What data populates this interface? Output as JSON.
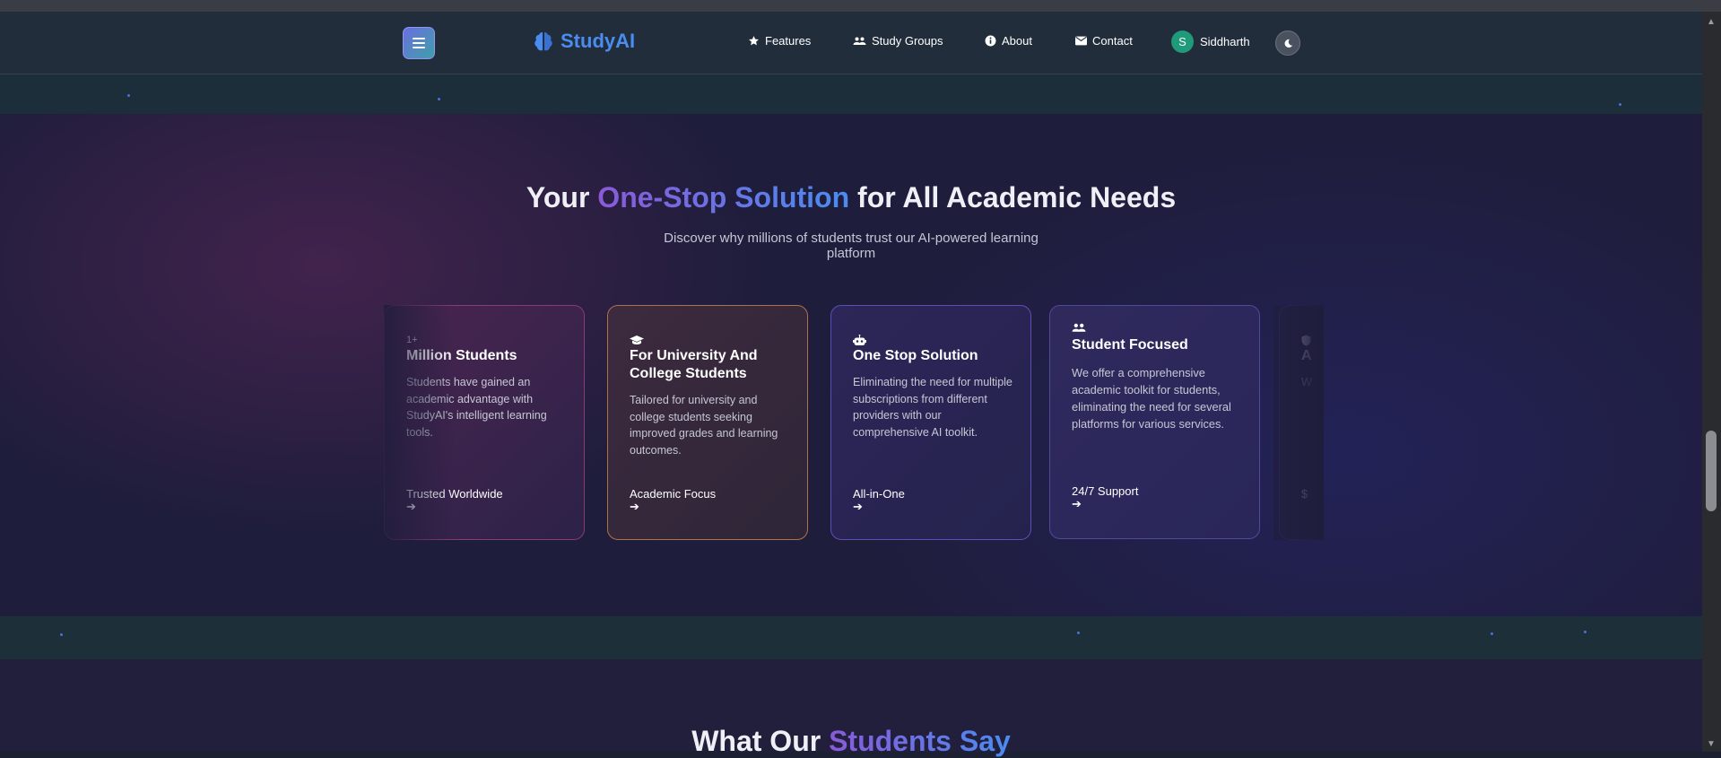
{
  "nav": {
    "brand": "StudyAI",
    "items": [
      {
        "label": "Features",
        "icon": "star-icon"
      },
      {
        "label": "Study Groups",
        "icon": "users-icon"
      },
      {
        "label": "About",
        "icon": "info-icon"
      },
      {
        "label": "Contact",
        "icon": "envelope-icon"
      }
    ],
    "user": {
      "initial": "S",
      "name": "Siddharth"
    },
    "theme_icon": "moon-icon"
  },
  "hero": {
    "heading_pre": "Your ",
    "heading_highlight": "One-Stop Solution",
    "heading_post": " for All Academic Needs",
    "subheading": "Discover why millions of students trust our AI-powered learning platform"
  },
  "cards": [
    {
      "stat": "1+",
      "title": "Million Students",
      "description": "Students have gained an academic advantage with StudyAI's intelligent learning tools.",
      "footer": "Trusted Worldwide",
      "icon": "none"
    },
    {
      "title": "For University And College Students",
      "description": "Tailored for university and college students seeking improved grades and learning outcomes.",
      "footer": "Academic Focus",
      "icon": "graduation-cap-icon"
    },
    {
      "title": "One Stop Solution",
      "description": "Eliminating the need for multiple subscriptions from different providers with our comprehensive AI toolkit.",
      "footer": "All-in-One",
      "icon": "robot-icon"
    },
    {
      "title": "Student Focused",
      "description": "We offer a comprehensive academic toolkit for students, eliminating the need for several platforms for various services.",
      "footer": "24/7 Support",
      "icon": "users-icon"
    },
    {
      "title": "A",
      "description": "W",
      "footer": "$",
      "icon": "shield-icon"
    }
  ],
  "next_section": {
    "heading_pre": "What Our ",
    "heading_highlight": "Students Say"
  },
  "colors": {
    "accent_blue": "#4a8cf0",
    "accent_purple": "#8a5ad8",
    "avatar": "#1f9a7a"
  }
}
